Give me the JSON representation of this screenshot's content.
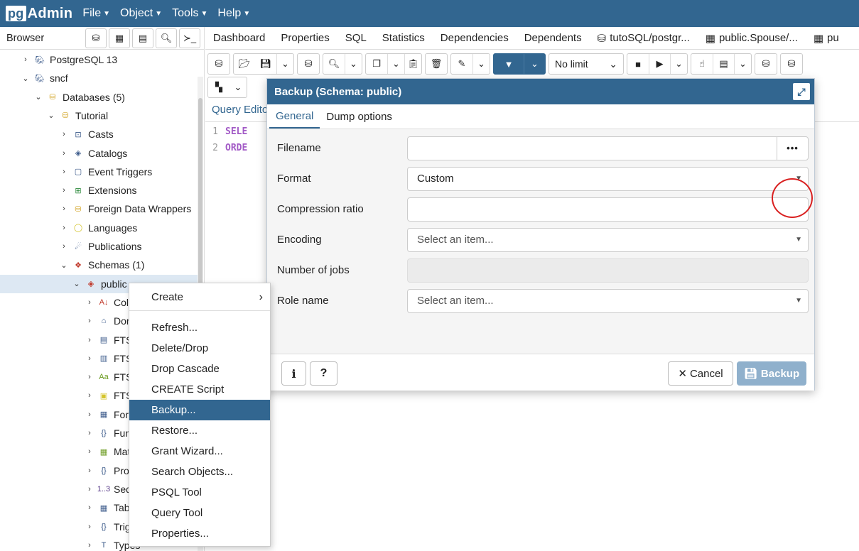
{
  "app": {
    "logo_pg": "pg",
    "logo_rest": "Admin"
  },
  "menu": [
    "File",
    "Object",
    "Tools",
    "Help"
  ],
  "sidebar": {
    "title": "Browser",
    "tree": [
      {
        "label": "PostgreSQL 13",
        "icon": "elephant-icon",
        "chev": "›"
      },
      {
        "label": "sncf",
        "icon": "elephant-icon",
        "chev": "⌄"
      },
      {
        "label": "Databases (5)",
        "icon": "databases-icon",
        "chev": "⌄"
      },
      {
        "label": "Tutorial",
        "icon": "database-icon",
        "chev": "⌄"
      },
      {
        "label": "Casts",
        "icon": "casts-icon",
        "chev": "›"
      },
      {
        "label": "Catalogs",
        "icon": "catalogs-icon",
        "chev": "›"
      },
      {
        "label": "Event Triggers",
        "icon": "event-triggers-icon",
        "chev": "›"
      },
      {
        "label": "Extensions",
        "icon": "extensions-icon",
        "chev": "›"
      },
      {
        "label": "Foreign Data Wrappers",
        "icon": "fdw-icon",
        "chev": "›"
      },
      {
        "label": "Languages",
        "icon": "languages-icon",
        "chev": "›"
      },
      {
        "label": "Publications",
        "icon": "publications-icon",
        "chev": "›"
      },
      {
        "label": "Schemas (1)",
        "icon": "schemas-icon",
        "chev": "⌄"
      },
      {
        "label": "public",
        "icon": "schema-icon",
        "chev": "⌄"
      },
      {
        "label": "Coll",
        "icon": "collations-icon",
        "chev": "›"
      },
      {
        "label": "Dor",
        "icon": "domains-icon",
        "chev": "›"
      },
      {
        "label": "FTS",
        "icon": "fts-config-icon",
        "chev": "›"
      },
      {
        "label": "FTS",
        "icon": "fts-dict-icon",
        "chev": "›"
      },
      {
        "label": "FTS",
        "icon": "fts-parser-icon",
        "chev": "›"
      },
      {
        "label": "FTS",
        "icon": "fts-template-icon",
        "chev": "›"
      },
      {
        "label": "Fore",
        "icon": "foreign-tables-icon",
        "chev": "›"
      },
      {
        "label": "Fun",
        "icon": "functions-icon",
        "chev": "›"
      },
      {
        "label": "Mat",
        "icon": "mat-views-icon",
        "chev": "›"
      },
      {
        "label": "Pro",
        "icon": "procedures-icon",
        "chev": "›"
      },
      {
        "label": "Seq",
        "icon": "sequences-icon",
        "chev": "›"
      },
      {
        "label": "Tab",
        "icon": "tables-icon",
        "chev": "›"
      },
      {
        "label": "Trig",
        "icon": "trigger-functions-icon",
        "chev": "›"
      },
      {
        "label": "Types",
        "icon": "types-icon",
        "chev": "›"
      }
    ]
  },
  "tabs": [
    "Dashboard",
    "Properties",
    "SQL",
    "Statistics",
    "Dependencies",
    "Dependents",
    "tutoSQL/postgr...",
    "public.Spouse/...",
    "pu"
  ],
  "toolbar": {
    "limit": "No limit"
  },
  "query": {
    "tab_label": "Query Edito",
    "lines": [
      {
        "n": "1",
        "text": "SELE"
      },
      {
        "n": "2",
        "text": "ORDE"
      }
    ]
  },
  "dialog": {
    "title": "Backup (Schema: public)",
    "tabs": [
      "General",
      "Dump options"
    ],
    "fields": {
      "filename": {
        "label": "Filename",
        "value": "",
        "button": "•••"
      },
      "format": {
        "label": "Format",
        "value": "Custom"
      },
      "compression": {
        "label": "Compression ratio",
        "value": ""
      },
      "encoding": {
        "label": "Encoding",
        "placeholder": "Select an item..."
      },
      "jobs": {
        "label": "Number of jobs",
        "value": ""
      },
      "role": {
        "label": "Role name",
        "placeholder": "Select an item..."
      }
    },
    "buttons": {
      "info": "i",
      "help": "?",
      "cancel": "Cancel",
      "backup": "Backup"
    }
  },
  "context_menu": {
    "create": "Create",
    "items": [
      "Refresh...",
      "Delete/Drop",
      "Drop Cascade",
      "CREATE Script",
      "Backup...",
      "Restore...",
      "Grant Wizard...",
      "Search Objects...",
      "PSQL Tool",
      "Query Tool",
      "Properties..."
    ],
    "active": "Backup..."
  },
  "colors": {
    "brand": "#326690",
    "highlight": "#d92020",
    "selected_row": "#dde8f3",
    "disabled_button": "#8fb0cc"
  }
}
